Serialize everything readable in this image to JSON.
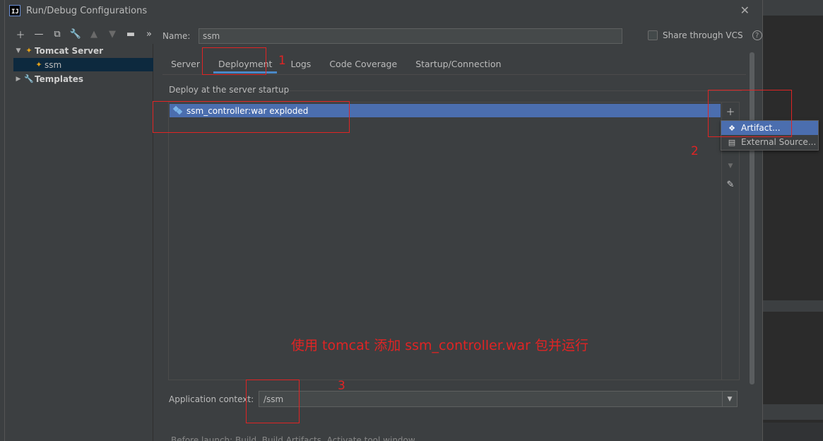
{
  "window": {
    "title": "Run/Debug Configurations",
    "app_icon_text": "IJ"
  },
  "tree": {
    "items": [
      {
        "label": "Tomcat Server",
        "expanded": true
      },
      {
        "label": "ssm",
        "selected": true
      },
      {
        "label": "Templates",
        "expanded": false
      }
    ]
  },
  "form": {
    "name_label": "Name:",
    "name_value": "ssm",
    "share_label": "Share through VCS",
    "share_checked": false
  },
  "tabs": [
    {
      "label": "Server"
    },
    {
      "label": "Deployment",
      "active": true
    },
    {
      "label": "Logs"
    },
    {
      "label": "Code Coverage"
    },
    {
      "label": "Startup/Connection"
    }
  ],
  "deploy": {
    "group_title": "Deploy at the server startup",
    "items": [
      "ssm_controller:war exploded"
    ],
    "add_menu": [
      "Artifact...",
      "External Source..."
    ]
  },
  "context": {
    "label": "Application context:",
    "value": "/ssm"
  },
  "below_text": "Before launch: Build, Build Artifacts, Activate tool window",
  "annotations": {
    "n1": "1",
    "n2": "2",
    "n3": "3",
    "note": "使用 tomcat 添加 ssm_controller.war 包并运行",
    "color": "#e02424"
  },
  "colors": {
    "selection": "#4b6eaf",
    "background": "#3c3f41",
    "tab_underline": "#4a88c7"
  }
}
